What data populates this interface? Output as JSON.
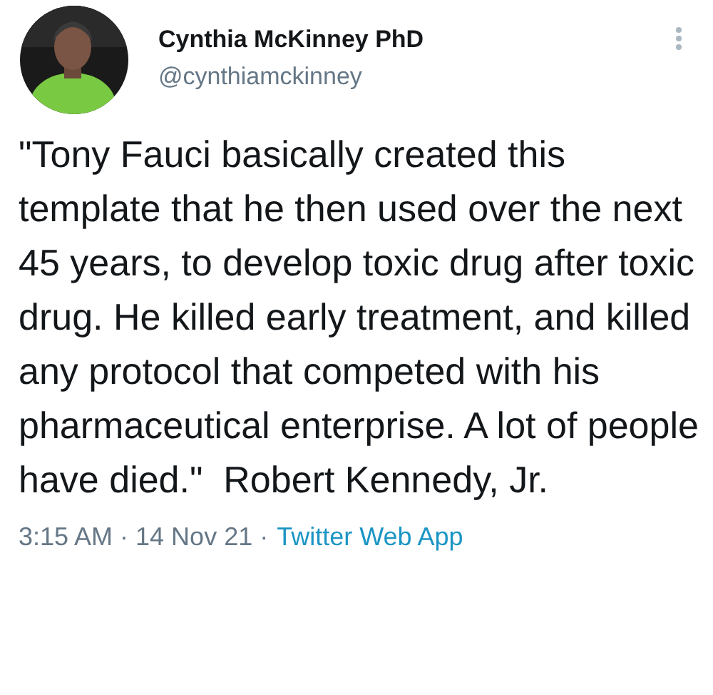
{
  "author": {
    "name": "Cynthia McKinney PhD",
    "handle": "@cynthiamckinney"
  },
  "tweet": {
    "text": "\"Tony Fauci basically created this template that he then used over the next 45 years, to develop toxic drug after toxic drug. He killed early treatment, and killed any protocol that competed with his pharmaceutical enterprise. A lot of people have died.\"  Robert Kennedy, Jr."
  },
  "footer": {
    "time": "3:15 AM · 14 Nov 21 ·",
    "source": "Twitter Web App"
  }
}
